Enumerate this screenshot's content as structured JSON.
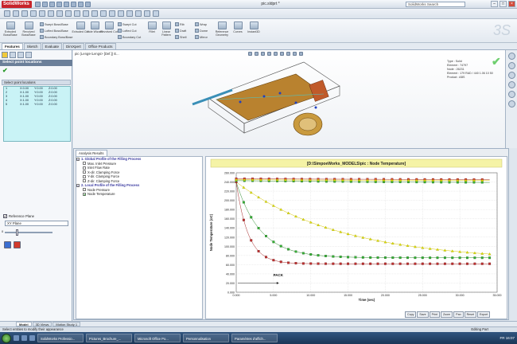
{
  "app": {
    "logo": "SolidWorks",
    "doc_title": "pic.sldprt *",
    "search_placeholder": "SolidWorks Search"
  },
  "ribbon": {
    "big_buttons": [
      {
        "label": "Extruded Boss/Base",
        "icon": "extrude-icon"
      },
      {
        "label": "Revolved Boss/Base",
        "icon": "revolve-icon"
      },
      {
        "label": "Extruded Cut",
        "icon": "extruded-cut-icon"
      },
      {
        "label": "Hole Wizard",
        "icon": "hole-wizard-icon"
      },
      {
        "label": "Revolved Cut",
        "icon": "revolved-cut-icon"
      },
      {
        "label": "Fillet",
        "icon": "fillet-icon"
      },
      {
        "label": "Linear Pattern",
        "icon": "linear-pattern-icon"
      },
      {
        "label": "Rib",
        "icon": "rib-icon"
      },
      {
        "label": "Reference Geometry",
        "icon": "reference-geometry-icon"
      },
      {
        "label": "Curves",
        "icon": "curves-icon"
      },
      {
        "label": "Instant3D",
        "icon": "instant3d-icon"
      }
    ],
    "small_buttons": [
      {
        "label": "Swept Boss/Base"
      },
      {
        "label": "Lofted Boss/Base"
      },
      {
        "label": "Boundary Boss/Base"
      },
      {
        "label": "Swept Cut"
      },
      {
        "label": "Lofted Cut"
      },
      {
        "label": "Boundary Cut"
      },
      {
        "label": "Draft"
      },
      {
        "label": "Shell"
      },
      {
        "label": "Wrap"
      },
      {
        "label": "Dome"
      },
      {
        "label": "Mirror"
      }
    ]
  },
  "tabs": [
    "Features",
    "Sketch",
    "Evaluate",
    "DimXpert",
    "Office Products"
  ],
  "left_panel": {
    "title": "Select point locations",
    "list_header": "Select point locations",
    "rows": [
      [
        "1",
        "X:0.00",
        "Y:0.00",
        "Z:0.00"
      ],
      [
        "2",
        "X:1.00",
        "Y:0.00",
        "Z:0.00"
      ],
      [
        "3",
        "X:1.00",
        "Y:0.00",
        "Z:0.00"
      ],
      [
        "4",
        "X:1.00",
        "Y:0.00",
        "Z:0.00"
      ],
      [
        "5",
        "X:1.00",
        "Y:0.00",
        "Z:0.00"
      ]
    ],
    "ref_plane_label": "Reference Plane",
    "ref_plane_value": "XY Plane",
    "slider_min": "0"
  },
  "model_view": {
    "breadcrumb": "pic (Lengs<Lengs> [Def.]) E...",
    "info_lines": [
      "Type : Solid",
      "Element : 74797",
      "Node : 26231",
      "Element : 179   RAD / 440   1.06   10   50",
      "Product : ABS"
    ]
  },
  "analysis": {
    "tab": "Analysis Results",
    "tree": [
      {
        "label": "1. Global Profile of the Filling Process",
        "group": true
      },
      {
        "label": "Max. Inlet Pressure",
        "checked": false
      },
      {
        "label": "Inlet Flow Rate",
        "checked": false
      },
      {
        "label": "X-dir. Clamping Force",
        "checked": false
      },
      {
        "label": "Y-dir. Clamping Force",
        "checked": false
      },
      {
        "label": "Z-dir. Clamping Force",
        "checked": false
      },
      {
        "label": "2. Local Profile of the Filling Process",
        "group": true
      },
      {
        "label": "Node Pressure",
        "checked": false
      },
      {
        "label": "Node Temperature",
        "checked": true
      }
    ],
    "buttons": [
      "Copy",
      "Save",
      "Print",
      "Zoom",
      "Pan",
      "Reset",
      "Export"
    ]
  },
  "chart_data": {
    "type": "line",
    "title": "[D:\\SimpoeWorks_MODELS\\pic : Node Temperature]",
    "xlabel": "Time (sec)",
    "ylabel": "Node Temperature (oC)",
    "xlim": [
      0,
      35
    ],
    "ylim": [
      0,
      260
    ],
    "xticks": [
      "0.000",
      "5.000",
      "10.000",
      "15.000",
      "20.000",
      "25.000",
      "30.000",
      "35.000"
    ],
    "yticks": [
      "0.000",
      "20.000",
      "40.000",
      "60.000",
      "80.000",
      "100.000",
      "120.000",
      "140.000",
      "160.000",
      "180.000",
      "200.000",
      "220.000",
      "240.000",
      "260.000"
    ],
    "annotation": "PACK",
    "annotation_x": 3.5,
    "series": [
      {
        "color": "#d9c800",
        "marker_color": "#e6e600",
        "marker_edge": "#8c8c00",
        "shape": "triangle",
        "start": 240,
        "end": 68,
        "tau": 14,
        "flat": 0
      },
      {
        "color": "#2e8b2e",
        "marker_color": "#34b334",
        "marker_edge": "#1c5a1c",
        "shape": "square",
        "start": 240,
        "end": 75,
        "tau": 3.2,
        "flat": 0
      },
      {
        "color": "#a52525",
        "marker_color": "#c43030",
        "marker_edge": "#5e0f0f",
        "shape": "square",
        "start": 240,
        "end": 62,
        "tau": 1.6,
        "flat": 0
      },
      {
        "color": "#2e8b2e",
        "marker_color": "#34b334",
        "marker_edge": "#1c5a1c",
        "shape": "square",
        "start": 243,
        "end": 236,
        "tau": 40,
        "flat": 1
      },
      {
        "color": "#a52525",
        "marker_color": "#e63030",
        "marker_edge": "#5e0f0f",
        "shape": "square",
        "start": 247,
        "end": 244,
        "tau": 40,
        "flat": 1
      },
      {
        "color": "#d9c800",
        "marker_color": "#e6e600",
        "marker_edge": "#8c8c00",
        "shape": "triangle",
        "start": 245,
        "end": 242,
        "tau": 40,
        "flat": 1
      }
    ]
  },
  "bottom_tabs": [
    "Model",
    "3D Views",
    "Motion Study 1"
  ],
  "status": {
    "left": "Select entities to modify their appearance",
    "right": "Editing Part"
  },
  "taskbar": {
    "items": [
      "SolidWorks Professio...",
      "Pictures_Brochure_...",
      "Microsoft Office Po...",
      "Personnalisation",
      "Paramètres d'affich..."
    ],
    "clock": "FR  16:07"
  }
}
